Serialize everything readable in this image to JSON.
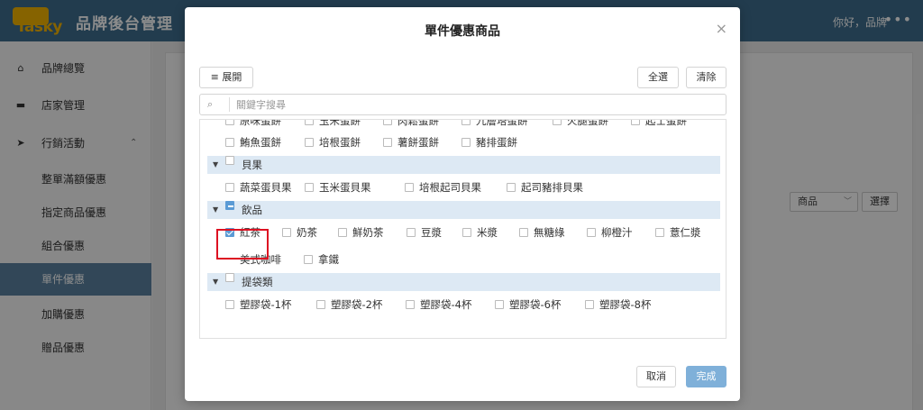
{
  "app": {
    "logo_text": "Tasky",
    "title": "品牌後台管理",
    "greeting": "你好，品牌",
    "more": "•••"
  },
  "sidebar": {
    "items": [
      {
        "label": "品牌總覽",
        "icon": "home-icon"
      },
      {
        "label": "店家管理",
        "icon": "store-icon"
      },
      {
        "label": "行銷活動",
        "icon": "megaphone-icon",
        "expanded": true
      },
      {
        "label": "整單滿額優惠"
      },
      {
        "label": "指定商品優惠"
      },
      {
        "label": "組合優惠"
      },
      {
        "label": "單件優惠",
        "active": true
      },
      {
        "label": "加購優惠"
      },
      {
        "label": "贈品優惠"
      }
    ]
  },
  "background_form": {
    "select_value": "商品",
    "select_button": "選擇"
  },
  "modal": {
    "title": "單件優惠商品",
    "expand_label": "展開",
    "select_all": "全選",
    "clear": "清除",
    "search_placeholder": "關鍵字搜尋",
    "cancel": "取消",
    "confirm": "完成",
    "tree": {
      "clipped_row": [
        "原味蛋餅",
        "玉米蛋餅",
        "肉鬆蛋餅",
        "九層塔蛋餅",
        "火腿蛋餅",
        "起士蛋餅"
      ],
      "egg_row2": [
        "鮪魚蛋餅",
        "培根蛋餅",
        "薯餅蛋餅",
        "豬排蛋餅"
      ],
      "categories": [
        {
          "label": "貝果",
          "state": "none",
          "items": [
            "蔬菜蛋貝果",
            "玉米蛋貝果",
            "培根起司貝果",
            "起司豬排貝果"
          ]
        },
        {
          "label": "飲品",
          "state": "partial",
          "items_row1": [
            "紅茶",
            "奶茶",
            "鮮奶茶",
            "豆漿",
            "米漿",
            "無糖綠",
            "柳橙汁",
            "薏仁漿"
          ],
          "items_row2": [
            "美式咖啡",
            "拿鐵"
          ],
          "checked": [
            "紅茶"
          ]
        },
        {
          "label": "提袋類",
          "state": "none",
          "items": [
            "塑膠袋-1杯",
            "塑膠袋-2杯",
            "塑膠袋-4杯",
            "塑膠袋-6杯",
            "塑膠袋-8杯"
          ]
        }
      ]
    }
  },
  "colors": {
    "topbar": "#3e6e8e",
    "sidebar_active": "#5b82a0",
    "category_row": "#dde9f4",
    "checkbox_checked": "#5b9bd5",
    "primary_button": "#7fb0d9",
    "highlight_box": "#dd1122"
  }
}
